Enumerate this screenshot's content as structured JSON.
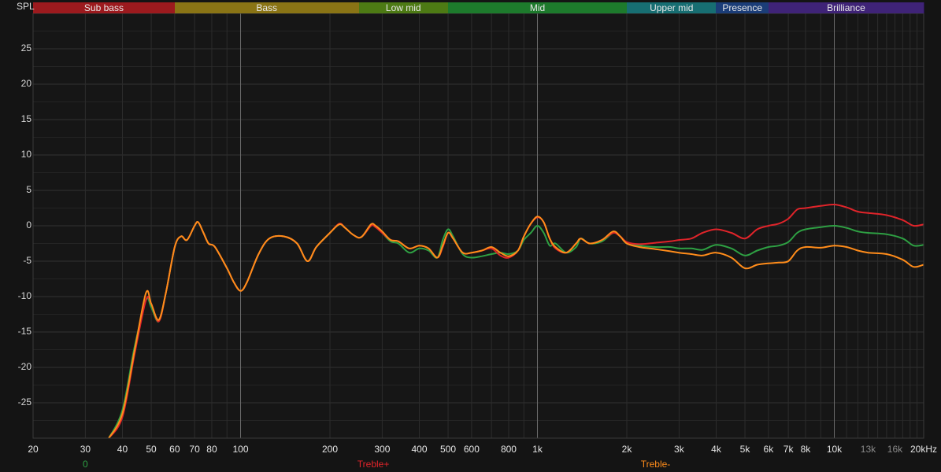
{
  "y_axis_label": "SPL",
  "bands": [
    {
      "label": "Sub bass",
      "from": 20,
      "to": 60,
      "color": "#9c1a1e"
    },
    {
      "label": "Bass",
      "from": 60,
      "to": 250,
      "color": "#8a7415"
    },
    {
      "label": "Low mid",
      "from": 250,
      "to": 500,
      "color": "#4d7a14"
    },
    {
      "label": "Mid",
      "from": 500,
      "to": 2000,
      "color": "#1d7a2c"
    },
    {
      "label": "Upper mid",
      "from": 2000,
      "to": 4000,
      "color": "#176e72"
    },
    {
      "label": "Presence",
      "from": 4000,
      "to": 6000,
      "color": "#1b3d78"
    },
    {
      "label": "Brilliance",
      "from": 6000,
      "to": 20000,
      "color": "#3f2377"
    }
  ],
  "y_ticks": [
    {
      "v": 25,
      "t": "25"
    },
    {
      "v": 20,
      "t": "20"
    },
    {
      "v": 15,
      "t": "15"
    },
    {
      "v": 10,
      "t": "10"
    },
    {
      "v": 5,
      "t": "5"
    },
    {
      "v": 0,
      "t": "0"
    },
    {
      "v": -5,
      "t": "-5"
    },
    {
      "v": -10,
      "t": "-10"
    },
    {
      "v": -15,
      "t": "-15"
    },
    {
      "v": -20,
      "t": "-20"
    },
    {
      "v": -25,
      "t": "-25"
    }
  ],
  "x_ticks": [
    {
      "f": 20,
      "t": "20"
    },
    {
      "f": 30,
      "t": "30"
    },
    {
      "f": 40,
      "t": "40"
    },
    {
      "f": 50,
      "t": "50"
    },
    {
      "f": 60,
      "t": "60"
    },
    {
      "f": 70,
      "t": "70"
    },
    {
      "f": 80,
      "t": "80"
    },
    {
      "f": 100,
      "t": "100"
    },
    {
      "f": 200,
      "t": "200"
    },
    {
      "f": 300,
      "t": "300"
    },
    {
      "f": 400,
      "t": "400"
    },
    {
      "f": 500,
      "t": "500"
    },
    {
      "f": 600,
      "t": "600"
    },
    {
      "f": 800,
      "t": "800"
    },
    {
      "f": 1000,
      "t": "1k"
    },
    {
      "f": 2000,
      "t": "2k"
    },
    {
      "f": 3000,
      "t": "3k"
    },
    {
      "f": 4000,
      "t": "4k"
    },
    {
      "f": 5000,
      "t": "5k"
    },
    {
      "f": 6000,
      "t": "6k"
    },
    {
      "f": 7000,
      "t": "7k"
    },
    {
      "f": 8000,
      "t": "8k"
    },
    {
      "f": 10000,
      "t": "10k"
    },
    {
      "f": 13000,
      "t": "13k",
      "dim": true
    },
    {
      "f": 16000,
      "t": "16k",
      "dim": true
    },
    {
      "f": 20000,
      "t": "20kHz"
    }
  ],
  "legend": [
    {
      "label": "0",
      "color": "#2ea043",
      "f": 30
    },
    {
      "label": "Treble+",
      "color": "#e0242a",
      "f": 280
    },
    {
      "label": "Treble-",
      "color": "#ff8c1a",
      "f": 2500
    }
  ],
  "chart_data": {
    "type": "line",
    "x_scale": "log",
    "xlim": [
      20,
      20000
    ],
    "ylim": [
      -30,
      30
    ],
    "xlabel": "",
    "ylabel": "SPL",
    "grid": true,
    "series": [
      {
        "name": "0",
        "color": "#2ea043",
        "points": [
          [
            36,
            -30
          ],
          [
            40,
            -26
          ],
          [
            44,
            -17
          ],
          [
            48,
            -10.5
          ],
          [
            50,
            -11.5
          ],
          [
            53,
            -13.5
          ],
          [
            56,
            -9.5
          ],
          [
            60,
            -3
          ],
          [
            63,
            -1.5
          ],
          [
            66,
            -2
          ],
          [
            70,
            0
          ],
          [
            72,
            0.5
          ],
          [
            75,
            -1
          ],
          [
            78,
            -2.5
          ],
          [
            82,
            -3
          ],
          [
            90,
            -6
          ],
          [
            95,
            -8
          ],
          [
            100,
            -9.2
          ],
          [
            105,
            -8
          ],
          [
            115,
            -4
          ],
          [
            125,
            -1.8
          ],
          [
            140,
            -1.5
          ],
          [
            155,
            -2.5
          ],
          [
            168,
            -5
          ],
          [
            180,
            -3
          ],
          [
            200,
            -1
          ],
          [
            215,
            0.2
          ],
          [
            225,
            -0.3
          ],
          [
            240,
            -1.3
          ],
          [
            255,
            -1.6
          ],
          [
            275,
            0
          ],
          [
            285,
            -0.2
          ],
          [
            300,
            -1
          ],
          [
            320,
            -2.2
          ],
          [
            340,
            -2.5
          ],
          [
            370,
            -3.8
          ],
          [
            400,
            -3.2
          ],
          [
            430,
            -3.5
          ],
          [
            460,
            -4.5
          ],
          [
            480,
            -2
          ],
          [
            500,
            -0.5
          ],
          [
            520,
            -1.5
          ],
          [
            560,
            -4
          ],
          [
            600,
            -4.5
          ],
          [
            650,
            -4.3
          ],
          [
            700,
            -4
          ],
          [
            750,
            -3.8
          ],
          [
            800,
            -4
          ],
          [
            860,
            -3.5
          ],
          [
            900,
            -2
          ],
          [
            950,
            -1
          ],
          [
            1000,
            0
          ],
          [
            1050,
            -1
          ],
          [
            1100,
            -2.8
          ],
          [
            1150,
            -2.5
          ],
          [
            1250,
            -3.8
          ],
          [
            1350,
            -3
          ],
          [
            1400,
            -1.8
          ],
          [
            1500,
            -2.5
          ],
          [
            1650,
            -2.2
          ],
          [
            1800,
            -1
          ],
          [
            1900,
            -1.5
          ],
          [
            2000,
            -2.5
          ],
          [
            2200,
            -2.8
          ],
          [
            2500,
            -3
          ],
          [
            2800,
            -3
          ],
          [
            3000,
            -3.2
          ],
          [
            3300,
            -3.2
          ],
          [
            3600,
            -3.4
          ],
          [
            4000,
            -2.7
          ],
          [
            4500,
            -3.2
          ],
          [
            5000,
            -4.2
          ],
          [
            5500,
            -3.5
          ],
          [
            6000,
            -3
          ],
          [
            6500,
            -2.8
          ],
          [
            7000,
            -2.3
          ],
          [
            7500,
            -1
          ],
          [
            8000,
            -0.5
          ],
          [
            9000,
            -0.2
          ],
          [
            10000,
            0
          ],
          [
            11000,
            -0.3
          ],
          [
            12000,
            -0.8
          ],
          [
            13000,
            -1
          ],
          [
            15000,
            -1.2
          ],
          [
            17000,
            -1.8
          ],
          [
            18500,
            -2.8
          ],
          [
            20000,
            -2.7
          ]
        ]
      },
      {
        "name": "Treble+",
        "color": "#e0242a",
        "points": [
          [
            36,
            -30
          ],
          [
            40,
            -27
          ],
          [
            44,
            -18
          ],
          [
            48,
            -10.5
          ],
          [
            50,
            -11
          ],
          [
            53,
            -13.5
          ],
          [
            56,
            -9.5
          ],
          [
            60,
            -3
          ],
          [
            63,
            -1.5
          ],
          [
            66,
            -2
          ],
          [
            70,
            0
          ],
          [
            72,
            0.5
          ],
          [
            75,
            -1
          ],
          [
            78,
            -2.5
          ],
          [
            82,
            -3
          ],
          [
            90,
            -6
          ],
          [
            95,
            -8
          ],
          [
            100,
            -9.2
          ],
          [
            105,
            -8
          ],
          [
            115,
            -4
          ],
          [
            125,
            -1.8
          ],
          [
            140,
            -1.5
          ],
          [
            155,
            -2.5
          ],
          [
            168,
            -5
          ],
          [
            180,
            -3
          ],
          [
            200,
            -1
          ],
          [
            215,
            0.3
          ],
          [
            225,
            -0.3
          ],
          [
            240,
            -1.3
          ],
          [
            255,
            -1.6
          ],
          [
            275,
            0
          ],
          [
            285,
            -0.2
          ],
          [
            300,
            -1
          ],
          [
            320,
            -2
          ],
          [
            340,
            -2.2
          ],
          [
            370,
            -3.2
          ],
          [
            400,
            -2.8
          ],
          [
            430,
            -3.2
          ],
          [
            460,
            -4.5
          ],
          [
            480,
            -3
          ],
          [
            500,
            -1
          ],
          [
            520,
            -1.8
          ],
          [
            560,
            -3.8
          ],
          [
            600,
            -3.8
          ],
          [
            650,
            -3.5
          ],
          [
            700,
            -3.2
          ],
          [
            750,
            -4.2
          ],
          [
            800,
            -4.5
          ],
          [
            860,
            -3.5
          ],
          [
            900,
            -1.5
          ],
          [
            950,
            0.3
          ],
          [
            1000,
            1.2
          ],
          [
            1050,
            0.5
          ],
          [
            1100,
            -1.8
          ],
          [
            1150,
            -3.2
          ],
          [
            1250,
            -3.8
          ],
          [
            1350,
            -2.5
          ],
          [
            1400,
            -1.8
          ],
          [
            1500,
            -2.5
          ],
          [
            1650,
            -2
          ],
          [
            1800,
            -1
          ],
          [
            1900,
            -1.5
          ],
          [
            2000,
            -2.3
          ],
          [
            2200,
            -2.6
          ],
          [
            2500,
            -2.4
          ],
          [
            2800,
            -2.2
          ],
          [
            3000,
            -2
          ],
          [
            3300,
            -1.8
          ],
          [
            3600,
            -1
          ],
          [
            4000,
            -0.5
          ],
          [
            4500,
            -1
          ],
          [
            5000,
            -1.8
          ],
          [
            5500,
            -0.5
          ],
          [
            6000,
            0
          ],
          [
            6500,
            0.3
          ],
          [
            7000,
            1
          ],
          [
            7500,
            2.3
          ],
          [
            8000,
            2.5
          ],
          [
            9000,
            2.8
          ],
          [
            10000,
            3
          ],
          [
            11000,
            2.6
          ],
          [
            12000,
            2
          ],
          [
            13000,
            1.8
          ],
          [
            15000,
            1.5
          ],
          [
            17000,
            0.8
          ],
          [
            18500,
            0
          ],
          [
            20000,
            0.2
          ]
        ]
      },
      {
        "name": "Treble-",
        "color": "#ff8c1a",
        "points": [
          [
            36,
            -30
          ],
          [
            40,
            -26.5
          ],
          [
            44,
            -17.5
          ],
          [
            48,
            -9.5
          ],
          [
            50,
            -11
          ],
          [
            53,
            -13.3
          ],
          [
            56,
            -9.5
          ],
          [
            60,
            -3
          ],
          [
            63,
            -1.5
          ],
          [
            66,
            -2
          ],
          [
            70,
            0
          ],
          [
            72,
            0.5
          ],
          [
            75,
            -1
          ],
          [
            78,
            -2.5
          ],
          [
            82,
            -3
          ],
          [
            90,
            -6
          ],
          [
            95,
            -8
          ],
          [
            100,
            -9.2
          ],
          [
            105,
            -8
          ],
          [
            115,
            -4
          ],
          [
            125,
            -1.8
          ],
          [
            140,
            -1.5
          ],
          [
            155,
            -2.5
          ],
          [
            168,
            -5
          ],
          [
            180,
            -3
          ],
          [
            200,
            -1
          ],
          [
            215,
            0.2
          ],
          [
            225,
            -0.3
          ],
          [
            240,
            -1.3
          ],
          [
            255,
            -1.6
          ],
          [
            275,
            0.2
          ],
          [
            285,
            0
          ],
          [
            300,
            -0.8
          ],
          [
            320,
            -2
          ],
          [
            340,
            -2.2
          ],
          [
            370,
            -3.2
          ],
          [
            400,
            -2.8
          ],
          [
            430,
            -3.2
          ],
          [
            460,
            -4.5
          ],
          [
            480,
            -2.8
          ],
          [
            500,
            -1
          ],
          [
            520,
            -1.8
          ],
          [
            560,
            -3.8
          ],
          [
            600,
            -3.8
          ],
          [
            650,
            -3.5
          ],
          [
            700,
            -3
          ],
          [
            750,
            -3.8
          ],
          [
            800,
            -4.3
          ],
          [
            860,
            -3.5
          ],
          [
            900,
            -1.5
          ],
          [
            950,
            0.3
          ],
          [
            1000,
            1.3
          ],
          [
            1050,
            0.5
          ],
          [
            1100,
            -1.8
          ],
          [
            1150,
            -3
          ],
          [
            1250,
            -3.8
          ],
          [
            1350,
            -2.5
          ],
          [
            1400,
            -1.8
          ],
          [
            1500,
            -2.5
          ],
          [
            1650,
            -2
          ],
          [
            1800,
            -0.8
          ],
          [
            1900,
            -1.5
          ],
          [
            2000,
            -2.5
          ],
          [
            2200,
            -3
          ],
          [
            2500,
            -3.3
          ],
          [
            2800,
            -3.6
          ],
          [
            3000,
            -3.8
          ],
          [
            3300,
            -4
          ],
          [
            3600,
            -4.2
          ],
          [
            4000,
            -3.8
          ],
          [
            4500,
            -4.5
          ],
          [
            5000,
            -6
          ],
          [
            5500,
            -5.5
          ],
          [
            6000,
            -5.3
          ],
          [
            6500,
            -5.2
          ],
          [
            7000,
            -5
          ],
          [
            7500,
            -3.5
          ],
          [
            8000,
            -3
          ],
          [
            9000,
            -3.1
          ],
          [
            10000,
            -2.8
          ],
          [
            11000,
            -3
          ],
          [
            12000,
            -3.5
          ],
          [
            13000,
            -3.8
          ],
          [
            15000,
            -4
          ],
          [
            17000,
            -4.8
          ],
          [
            18500,
            -5.8
          ],
          [
            20000,
            -5.5
          ]
        ]
      }
    ]
  }
}
